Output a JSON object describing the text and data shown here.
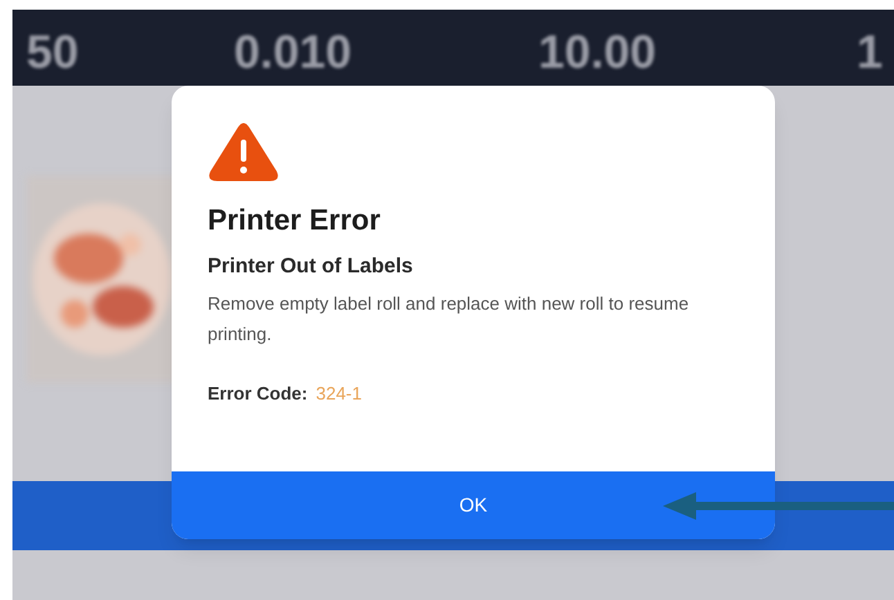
{
  "top_bar": {
    "readings": [
      "50",
      "0.010",
      "10.00",
      "1"
    ]
  },
  "dialog": {
    "title": "Printer Error",
    "subtitle": "Printer Out of Labels",
    "message": "Remove empty label roll and replace with new roll to resume printing.",
    "code_label": "Error Code:",
    "code": "324-1",
    "button": "OK"
  }
}
